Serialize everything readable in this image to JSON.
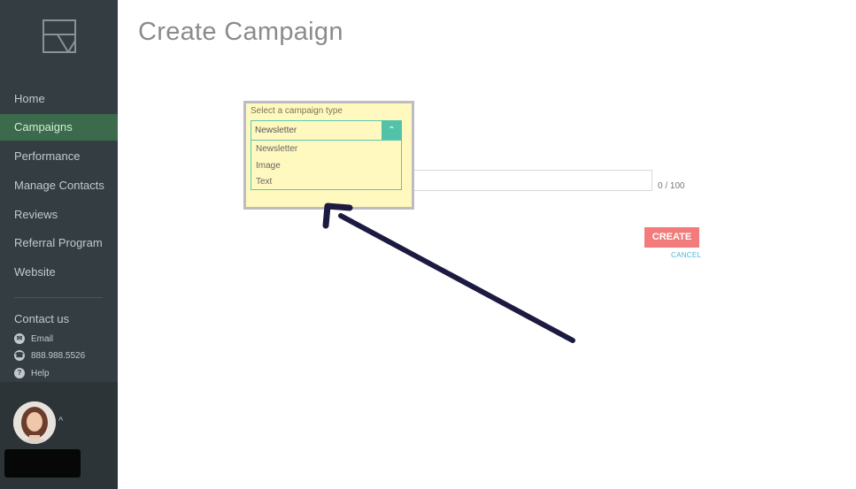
{
  "sidebar": {
    "logo_icon": "folded-document-icon",
    "nav": [
      {
        "label": "Home",
        "active": false
      },
      {
        "label": "Campaigns",
        "active": true
      },
      {
        "label": "Performance",
        "active": false
      },
      {
        "label": "Manage Contacts",
        "active": false
      },
      {
        "label": "Reviews",
        "active": false
      },
      {
        "label": "Referral Program",
        "active": false
      },
      {
        "label": "Website",
        "active": false
      }
    ],
    "contact": {
      "title": "Contact us",
      "email": "Email",
      "phone": "888.988.5526",
      "help": "Help"
    }
  },
  "page": {
    "title": "Create Campaign"
  },
  "form": {
    "select_label": "Select a campaign type",
    "selected": "Newsletter",
    "options": [
      "Newsletter",
      "Image",
      "Text"
    ],
    "counter": "0 / 100",
    "create_label": "CREATE",
    "cancel_label": "CANCEL"
  },
  "colors": {
    "sidebar": "#343d42",
    "active_nav": "#3b6b4c",
    "highlight": "#fff9bf",
    "accent": "#52c3a8",
    "create": "#f27b7b",
    "arrow": "#1c1a40"
  }
}
